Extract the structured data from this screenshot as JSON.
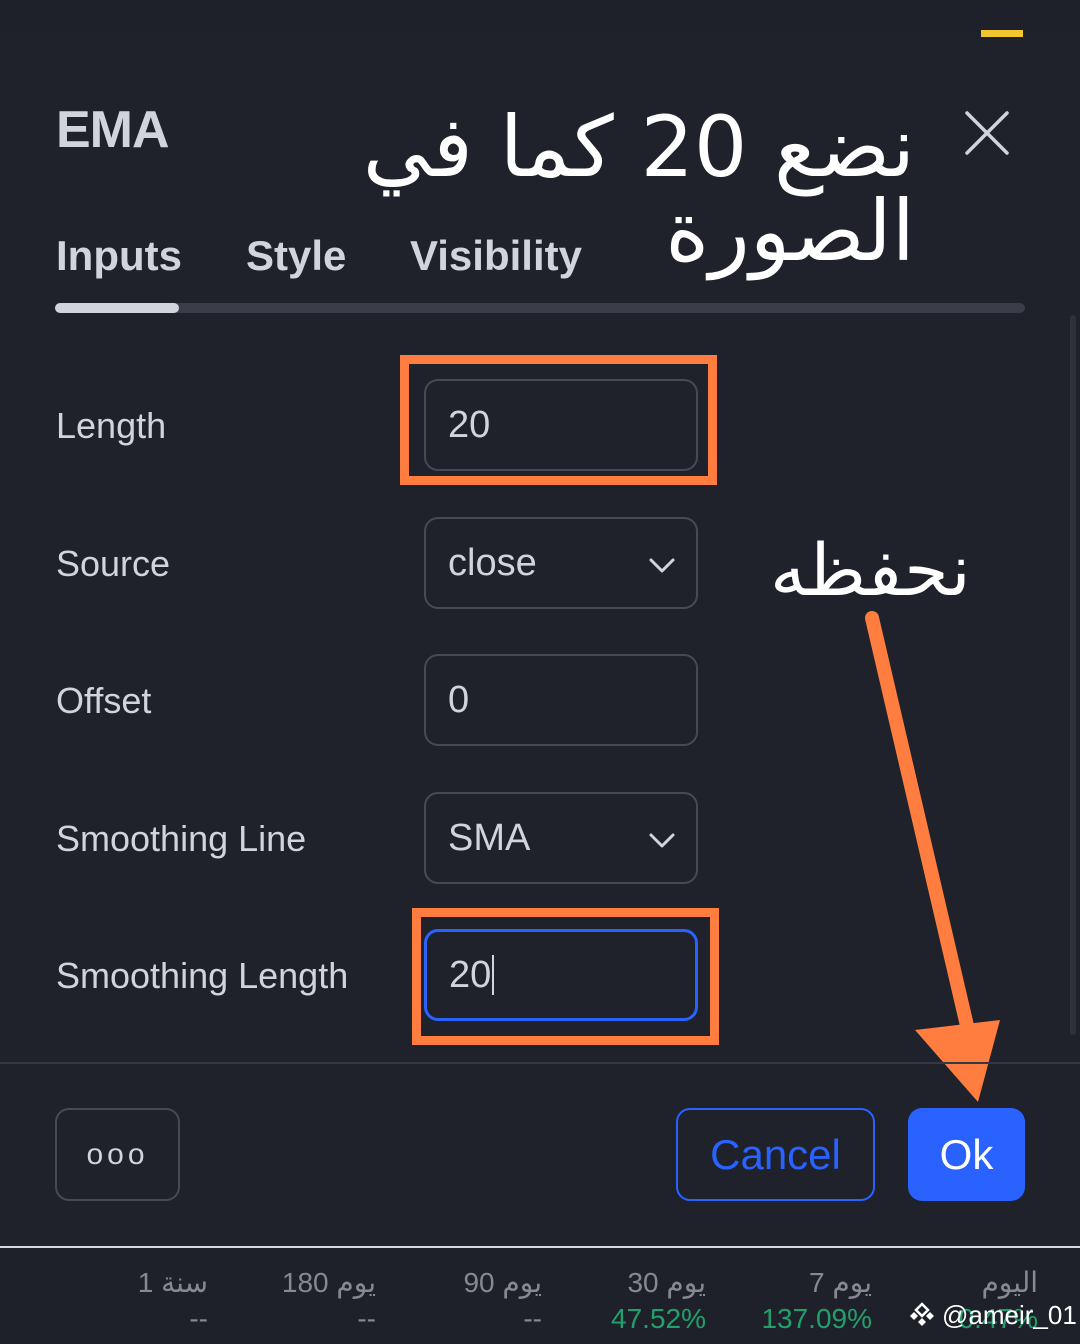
{
  "dialog": {
    "title": "EMA",
    "tabs": [
      "Inputs",
      "Style",
      "Visibility"
    ],
    "active_tab": "Inputs"
  },
  "inputs": {
    "length": {
      "label": "Length",
      "value": "20"
    },
    "source": {
      "label": "Source",
      "value": "close"
    },
    "offset": {
      "label": "Offset",
      "value": "0"
    },
    "smoothing_line": {
      "label": "Smoothing Line",
      "value": "SMA"
    },
    "smoothing_length": {
      "label": "Smoothing Length",
      "value": "20"
    }
  },
  "footer": {
    "more_label": "ooo",
    "cancel_label": "Cancel",
    "ok_label": "Ok"
  },
  "annotations": {
    "top_text": "نضع 20 كما في الصورة",
    "save_text": "نحفظه",
    "highlight_color": "#ff7d3e"
  },
  "performance": [
    {
      "label": "اليوم",
      "value": "0.47%"
    },
    {
      "label": "7 يوم",
      "value": "137.09%"
    },
    {
      "label": "30 يوم",
      "value": "47.52%"
    },
    {
      "label": "90 يوم",
      "value": "--"
    },
    {
      "label": "180 يوم",
      "value": "--"
    },
    {
      "label": "1 سنة",
      "value": "--"
    }
  ],
  "watermark": {
    "text": "@ameir_01",
    "icon": "binance-diamond-icon"
  },
  "colors": {
    "accent_blue": "#2962ff",
    "background": "#1f222b",
    "positive_green": "#22a06b",
    "top_indicator": "#f0c52e"
  }
}
